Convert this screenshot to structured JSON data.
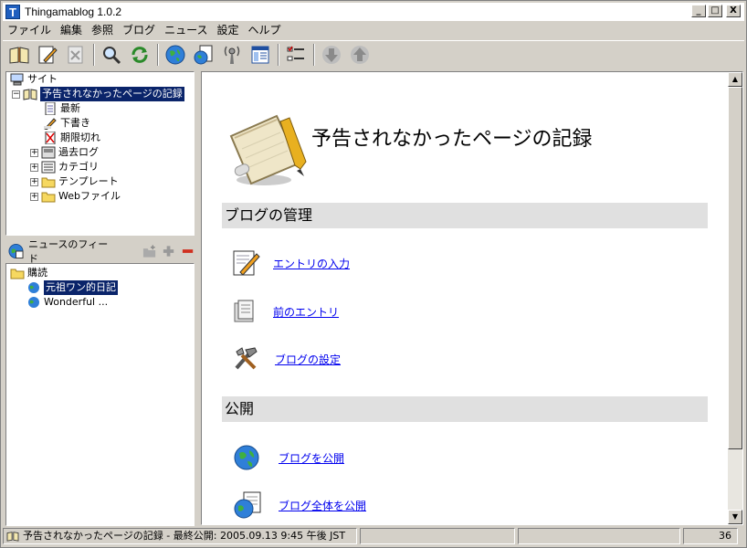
{
  "window": {
    "title": "Thingamablog 1.0.2",
    "icon_letter": "T",
    "controls": {
      "minimize": "_",
      "maximize": "□",
      "close": "X"
    }
  },
  "menu": [
    "ファイル",
    "編集",
    "参照",
    "ブログ",
    "ニュース",
    "設定",
    "ヘルプ"
  ],
  "toolbar": {
    "icons": [
      "open-book-icon",
      "edit-entry-icon",
      "delete-entry-icon",
      "search-icon",
      "refresh-icon",
      "publish-globe-icon",
      "publish-all-icon",
      "ping-icon",
      "layout-icon",
      "properties-icon",
      "move-down-icon",
      "move-up-icon"
    ]
  },
  "site_tree": {
    "root": "サイト",
    "blog": "予告されなかったページの記録",
    "children": [
      "最新",
      "下書き",
      "期限切れ",
      "過去ログ",
      "カテゴリ",
      "テンプレート",
      "Webファイル"
    ]
  },
  "news": {
    "header": "ニュースのフィード",
    "folder": "購読",
    "feeds": [
      "元祖ワン的日記",
      "Wonderful ..."
    ]
  },
  "main": {
    "blog_title": "予告されなかったページの記録",
    "sections": [
      {
        "title": "ブログの管理",
        "actions": [
          "エントリの入力",
          "前のエントリ",
          "ブログの設定"
        ]
      },
      {
        "title": "公開",
        "actions": [
          "ブログを公開",
          "ブログ全体を公開"
        ]
      }
    ]
  },
  "status": {
    "text": "予告されなかったページの記録 - 最終公開: 2005.09.13 9:45 午後 JST",
    "count": "36"
  },
  "colors": {
    "selection": "#0a246a",
    "link": "#0000ee",
    "section_bg": "#e0e0e0"
  }
}
